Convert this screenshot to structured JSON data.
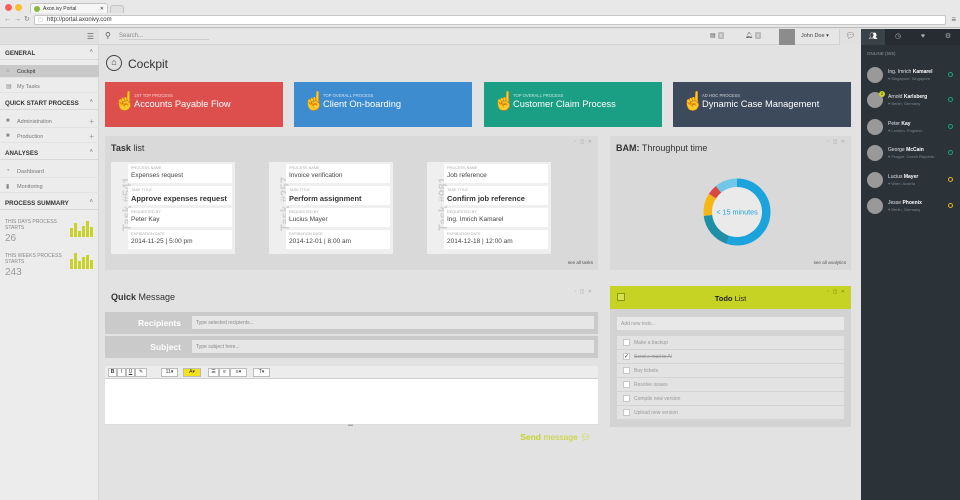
{
  "browser": {
    "tab_title": "Axon.ivy Portal",
    "url": "http://portal.axonivy.com"
  },
  "header": {
    "search_placeholder": "Search...",
    "tasks_badge": "2",
    "notifications_badge": "4",
    "user_name": "John Doe"
  },
  "sidebar": {
    "general": "GENERAL",
    "cockpit": "Cockpit",
    "my_tasks": "My Tasks",
    "quick_start": "QUICK START PROCESS",
    "administration": "Administration",
    "production": "Production",
    "analyses": "ANALYSES",
    "dashboard": "Dashboard",
    "monitoring": "Monitoring",
    "summary": "PROCESS SUMMARY",
    "today_label": "THIS DAYS PROCESS STARTS",
    "today_value": "26",
    "week_label": "THIS WEEKS PROCESS STARTS",
    "week_value": "243",
    "today_bars": [
      0.55,
      0.85,
      0.4,
      0.7,
      1.0,
      0.6
    ],
    "week_bars": [
      0.6,
      1.0,
      0.5,
      0.75,
      0.9,
      0.55
    ]
  },
  "page": {
    "title": "Cockpit"
  },
  "tiles": [
    {
      "sub": "1st top process",
      "name": "Accounts Payable Flow",
      "color": "#dd4f4d"
    },
    {
      "sub": "top overall process",
      "name": "Client On-boarding",
      "color": "#3d8cd0"
    },
    {
      "sub": "top overall process",
      "name": "Customer Claim Process",
      "color": "#1a9f85"
    },
    {
      "sub": "ad hoc process",
      "name": "Dynamic Case Management",
      "color": "#3d4a5b"
    }
  ],
  "task_list": {
    "title_bold": "Task",
    "title_rest": " list",
    "see_all": "see all tasks",
    "lbl_process": "PROCESS NAME",
    "lbl_task": "TASK TITLE",
    "lbl_requested": "REQUESTED BY",
    "lbl_expiration": "EXPIRATION DATE",
    "tasks": [
      {
        "num": "Task #541",
        "process": "Expenses request",
        "title": "Approve expenses request",
        "requested": "Peter Kay",
        "expiration": "2014-11-25 | 5:00 pm"
      },
      {
        "num": "Task #257",
        "process": "Invoice verification",
        "title": "Perform assignment",
        "requested": "Lucius Mayer",
        "expiration": "2014-12-01 | 8:00 am"
      },
      {
        "num": "Task #981",
        "process": "Job reference",
        "title": "Confirm job reference",
        "requested": "Ing. Imrich Kamarel",
        "expiration": "2014-12-18 | 12:00 am"
      }
    ]
  },
  "bam": {
    "title_bold": "BAM:",
    "title_rest": " Throughput time",
    "center": "< 15 minutes",
    "see_all": "see all analytics",
    "segments": [
      {
        "value": 55,
        "color": "#1ca3dc"
      },
      {
        "value": 18,
        "color": "#1f8fa5"
      },
      {
        "value": 11,
        "color": "#f4b716"
      },
      {
        "value": 5,
        "color": "#d94944"
      },
      {
        "value": 11,
        "color": "#71c7e8"
      }
    ]
  },
  "quick_message": {
    "title_bold": "Quick",
    "title_rest": " Message",
    "recipients_label": "Recipients",
    "recipients_placeholder": "Type selected recipients...",
    "subject_label": "Subject",
    "subject_placeholder": "Type subject here...",
    "send_bold": "Send",
    "send_rest": " message",
    "toolbar": {
      "bold": "B",
      "italic": "I",
      "underline": "U",
      "fontsize": "11",
      "color": "A",
      "font": "T"
    }
  },
  "todo": {
    "title_bold": "Todo",
    "title_rest": " List",
    "input_placeholder": "Add new todo...",
    "items": [
      {
        "label": "Make a backup",
        "done": false
      },
      {
        "label": "Send e-mail to Al",
        "done": true
      },
      {
        "label": "Buy tickets",
        "done": false
      },
      {
        "label": "Resolve issues",
        "done": false
      },
      {
        "label": "Compile new version",
        "done": false
      },
      {
        "label": "Upload new version",
        "done": false
      }
    ]
  },
  "online": {
    "label": "ONLINE (555)",
    "users": [
      {
        "first": "Ing. Imrich",
        "last": "Kamarel",
        "loc": "Singapore, Singapore",
        "status": "#1aa37a",
        "badge": ""
      },
      {
        "first": "Arnold",
        "last": "Karlsberg",
        "loc": "Berlin, Germany",
        "status": "#1aa37a",
        "badge": "2"
      },
      {
        "first": "Peter",
        "last": "Kay",
        "loc": "London, England",
        "status": "#1aa37a",
        "badge": ""
      },
      {
        "first": "George",
        "last": "McCain",
        "loc": "Prague, Czech Republic",
        "status": "#1aa37a",
        "badge": ""
      },
      {
        "first": "Lucius",
        "last": "Mayer",
        "loc": "Wien, Austria",
        "status": "#e6b217",
        "badge": ""
      },
      {
        "first": "Jesse",
        "last": "Phoenix",
        "loc": "Berlin, Germany",
        "status": "#e6b217",
        "badge": ""
      }
    ]
  }
}
